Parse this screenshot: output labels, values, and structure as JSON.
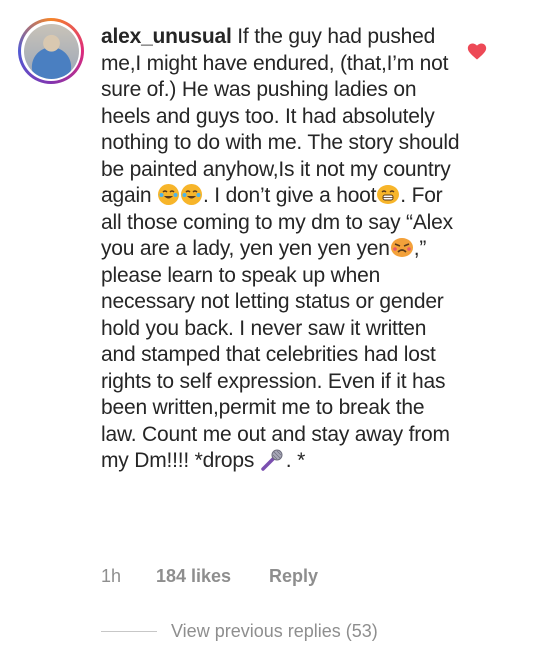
{
  "comment": {
    "username": "alex_unusual",
    "text_part1": " If the guy had pushed me,I might have endured, (that,I’m not sure of.) He was pushing ladies on heels and guys too. It had absolutely nothing to do with me. The story should be painted anyhow,Is it not my country again ",
    "text_part2": ". I don’t give a hoot",
    "text_part3": ". For all those coming to my dm to say “Alex you are a lady, yen yen yen yen",
    "text_part4": ",” please learn to speak up when necessary not letting status or gender hold you back. I never saw it written and stamped that celebrities had lost rights to self expression. Even if it has been written,permit me to break the law. Count me out and stay away from my Dm!!!! *drops ",
    "text_part5": ". *",
    "liked": true
  },
  "meta": {
    "time": "1h",
    "likes": "184 likes",
    "reply_label": "Reply"
  },
  "replies": {
    "label": "View previous replies (53)"
  },
  "colors": {
    "heart": "#ed4956",
    "meta": "#8e8e8e",
    "text": "#262626"
  },
  "icons": [
    "avatar",
    "heart-icon",
    "crying-laughing-emoji",
    "grinning-emoji",
    "angry-emoji",
    "microphone-emoji"
  ]
}
